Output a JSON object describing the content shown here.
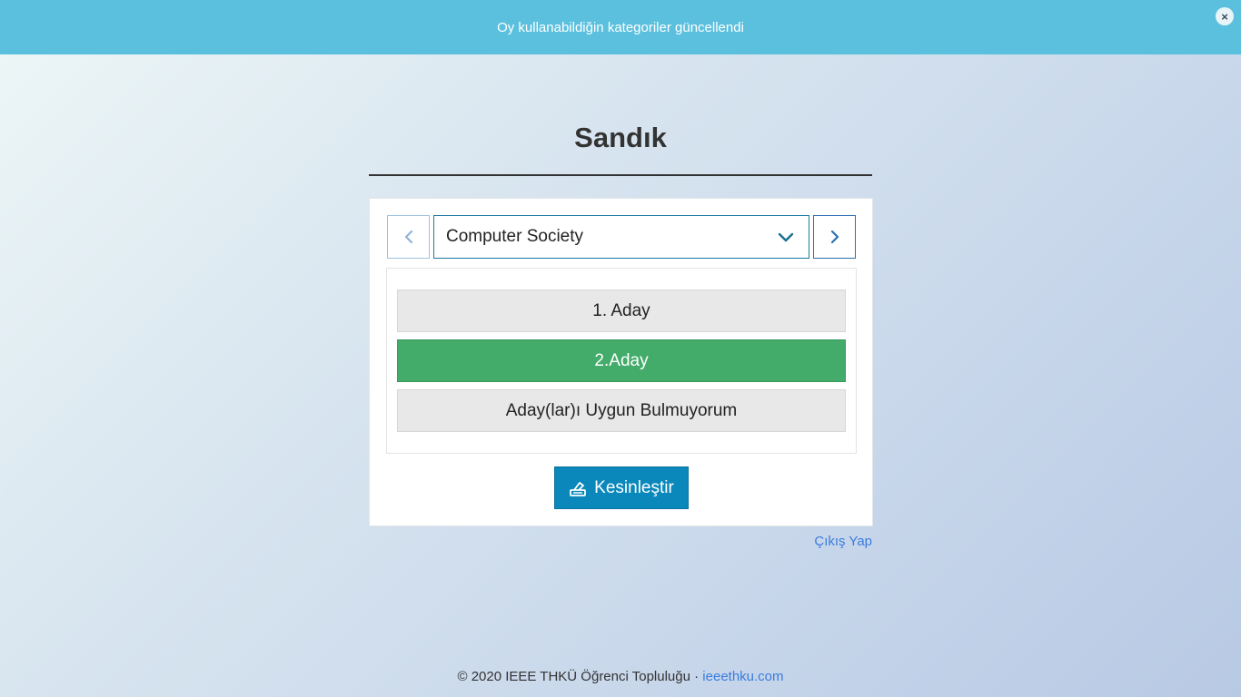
{
  "notice": {
    "message": "Oy kullanabildiğin kategoriler güncellendi",
    "close_label": "×",
    "background_color": "#5bc0de"
  },
  "page": {
    "title": "Sandık"
  },
  "category_nav": {
    "prev_icon": "chevron-left-icon",
    "next_icon": "chevron-right-icon",
    "selected_category": "Computer Society",
    "dropdown_icon": "chevron-down-icon"
  },
  "options": [
    {
      "label": "1. Aday",
      "selected": false
    },
    {
      "label": "2.Aday",
      "selected": true
    },
    {
      "label": "Aday(lar)ı Uygun Bulmuyorum",
      "selected": false
    }
  ],
  "submit": {
    "label": "Kesinleştir",
    "icon": "ballot-box-icon",
    "color": "#0a88bb"
  },
  "selected_color": "#43ac6a",
  "logout": {
    "label": "Çıkış Yap"
  },
  "footer": {
    "copyright": "© 2020 IEEE THKÜ Öğrenci Topluluğu",
    "separator": "·",
    "link_text": "ieeethku.com"
  }
}
